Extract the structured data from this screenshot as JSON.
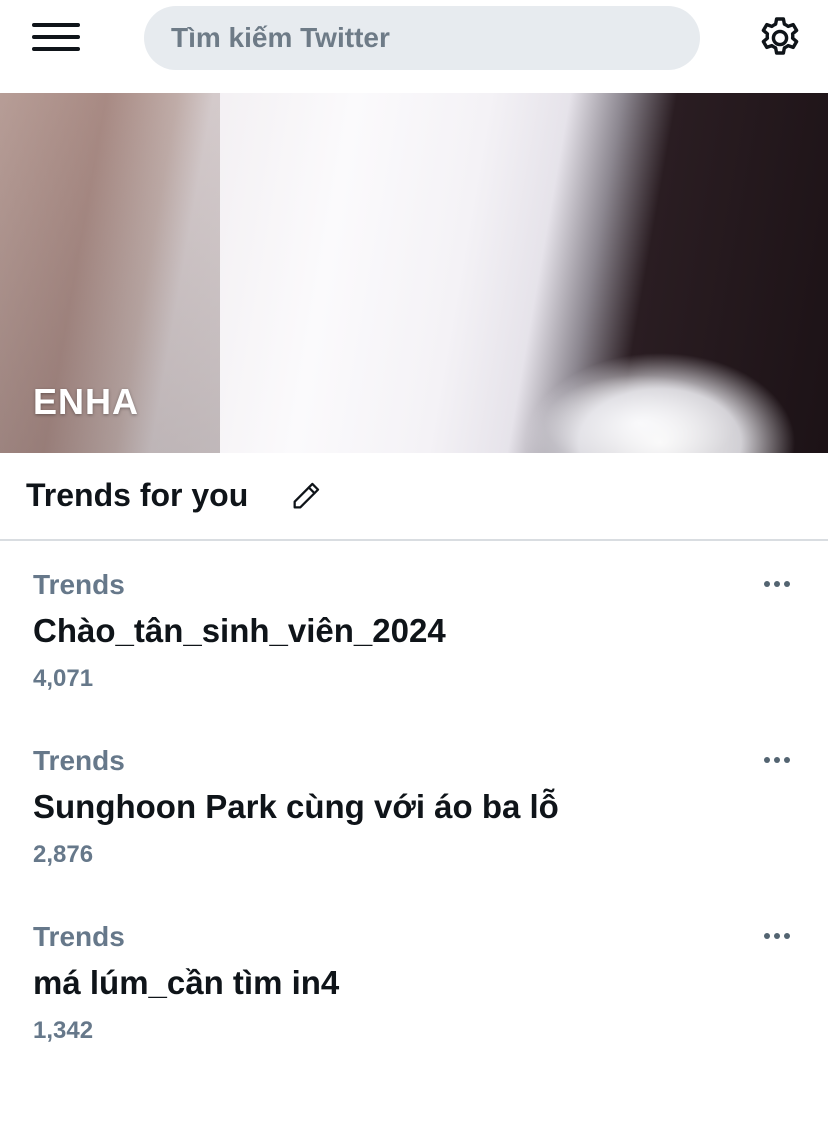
{
  "header": {
    "menu_icon": "hamburger-menu-icon",
    "search_placeholder": "Tìm kiếm Twitter",
    "settings_icon": "gear-icon"
  },
  "hero": {
    "title": "ENHA"
  },
  "trends_section": {
    "title": "Trends for you",
    "edit_icon": "pencil-icon",
    "items": [
      {
        "category": "Trends",
        "name": "Chào_tân_sinh_viên_2024",
        "count": "4,071"
      },
      {
        "category": "Trends",
        "name": "Sunghoon Park cùng với áo ba lỗ",
        "count": "2,876"
      },
      {
        "category": "Trends",
        "name": "má lúm_cần tìm in4",
        "count": "1,342"
      }
    ]
  },
  "colors": {
    "text_primary": "#0f1419",
    "text_secondary": "#66788a",
    "search_bg": "#e7ebef",
    "divider": "#d9dde1"
  }
}
